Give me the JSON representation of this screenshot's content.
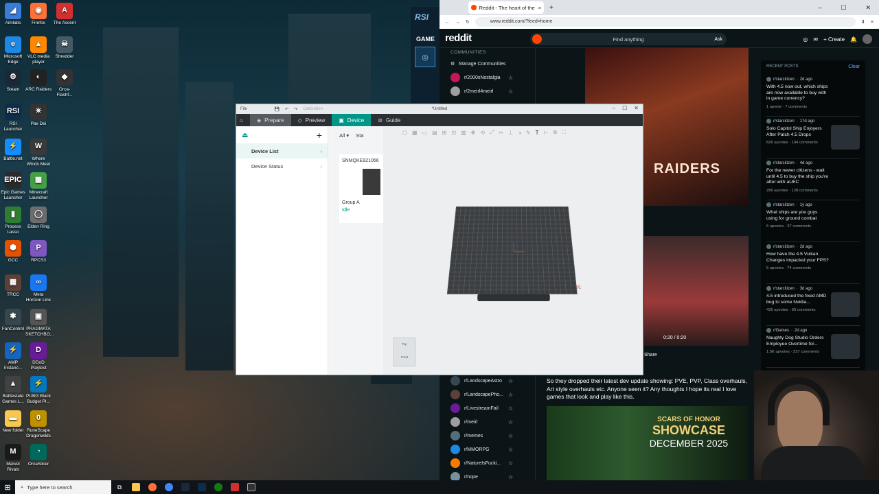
{
  "desktop": {
    "icons": [
      {
        "label": "Aimlabs",
        "glyph": "◢",
        "color": "#3a7bd5"
      },
      {
        "label": "Microsoft Edge",
        "glyph": "e",
        "color": "#1e88e5"
      },
      {
        "label": "Steam",
        "glyph": "⚙",
        "color": "#1b2838"
      },
      {
        "label": "RSI Launcher",
        "glyph": "RSI",
        "color": "#0d2d4a"
      },
      {
        "label": "Battle.net",
        "glyph": "⚡",
        "color": "#148eff"
      },
      {
        "label": "Epic Games Launcher",
        "glyph": "EPIC",
        "color": "#2a2a2a"
      },
      {
        "label": "Process Lasso",
        "glyph": "▮",
        "color": "#2e7d32"
      },
      {
        "label": "GCC",
        "glyph": "⬢",
        "color": "#e65100"
      },
      {
        "label": "TRCC",
        "glyph": "▦",
        "color": "#5d4037"
      },
      {
        "label": "FanControl",
        "glyph": "✱",
        "color": "#37474f"
      },
      {
        "label": "AMP Instanc...",
        "glyph": "⚡",
        "color": "#1565c0"
      },
      {
        "label": "Battlestate Games L...",
        "glyph": "▲",
        "color": "#424242"
      },
      {
        "label": "New folder",
        "glyph": "▬",
        "color": "#f9c74f"
      },
      {
        "label": "Marvel Rivals",
        "glyph": "M",
        "color": "#1a1a1a"
      },
      {
        "label": "Firefox",
        "glyph": "◉",
        "color": "#ff7139"
      },
      {
        "label": "VLC media player",
        "glyph": "▲",
        "color": "#ff8800"
      },
      {
        "label": "ARC Raiders",
        "glyph": "◐",
        "color": "#222"
      },
      {
        "label": "Pax Dei",
        "glyph": "✳",
        "color": "#333"
      },
      {
        "label": "Where Winds Meet",
        "glyph": "W",
        "color": "#3a3a3a"
      },
      {
        "label": "Minecraft Launcher",
        "glyph": "▩",
        "color": "#43a047"
      },
      {
        "label": "Elden Ring",
        "glyph": "◯",
        "color": "#6d6d6d"
      },
      {
        "label": "RPCS3",
        "glyph": "P",
        "color": "#7e57c2"
      },
      {
        "label": "Meta Horizon Link",
        "glyph": "∞",
        "color": "#1877f2"
      },
      {
        "label": "PRAGMATA SKETCHBO...",
        "glyph": "▣",
        "color": "#555"
      },
      {
        "label": "DDoD Playtest",
        "glyph": "D",
        "color": "#6a1b9a"
      },
      {
        "label": "PUBG Black Budget Pl...",
        "glyph": "⚡",
        "color": "#0277bd"
      },
      {
        "label": "RuneScape Dragonwilds",
        "glyph": "0",
        "color": "#bf9000"
      },
      {
        "label": "OrcaSlicer",
        "glyph": "◔",
        "color": "#00695c"
      },
      {
        "label": "The Ascent",
        "glyph": "A",
        "color": "#d32f2f"
      },
      {
        "label": "Shredder",
        "glyph": "☠",
        "color": "#455a64"
      },
      {
        "label": "Orca-Flashf...",
        "glyph": "◆",
        "color": "#333"
      }
    ]
  },
  "rsi_launcher": {
    "logo": "RSI",
    "game": "GAME"
  },
  "browser": {
    "tab_title": "Reddit - The heart of the intern",
    "url": "www.reddit.com/?feed=home",
    "reddit_logo": "reddit",
    "search_placeholder": "Find anything",
    "ask_label": "Ask",
    "create_label": "Create",
    "sidebar_heading": "COMMUNITIES",
    "manage_label": "Manage Communities",
    "communities_top": [
      {
        "name": "r/2000sNostalgia",
        "color": "#c2185b"
      },
      {
        "name": "r/2meirl4meirl",
        "color": "#9e9e9e"
      }
    ],
    "communities_bottom": [
      {
        "name": "r/LandscapeAstro",
        "color": "#37474f"
      },
      {
        "name": "r/LandscapePho...",
        "color": "#5d4037"
      },
      {
        "name": "r/LivestreamFail",
        "color": "#6a1b9a"
      },
      {
        "name": "r/meirl",
        "color": "#9e9e9e"
      },
      {
        "name": "r/memes",
        "color": "#546e7a"
      },
      {
        "name": "r/MMORPG",
        "color": "#1e88e5"
      },
      {
        "name": "r/NatureIsFucki...",
        "color": "#f57c00"
      },
      {
        "name": "r/nope",
        "color": "#78909c"
      }
    ],
    "feed": {
      "banner_text": "RAIDERS",
      "video_time": "0:20 / 0:20",
      "share_label": "Share",
      "post_text": "So they dropped their latest dev update showing: PVE, PVP, Class overhauls, Art style overhauls etc. Anyone seen it? Any thoughts I hope its real I love games that look and play like this.",
      "showcase_title": "SCARS OF HONOR",
      "showcase_sub": "SHOWCASE",
      "showcase_date": "DECEMBER 2025"
    },
    "recent": {
      "heading": "RECENT POSTS",
      "clear": "Clear",
      "posts": [
        {
          "sub": "r/starcitizen",
          "age": "2d ago",
          "title": "With 4.5 now out, which ships are now available to buy with in game currency?",
          "meta": "1 upvote · 7 comments",
          "thumb": false
        },
        {
          "sub": "r/starcitizen",
          "age": "17d ago",
          "title": "Solo Capitol Ship Enjoyers After Patch 4.5 Drops",
          "meta": "826 upvotes · 194 comments",
          "thumb": true
        },
        {
          "sub": "r/starcitizen",
          "age": "4d ago",
          "title": "For the newer citizens - wait until 4.5 to buy the ship you're after with aUEC",
          "meta": "286 upvotes · 128 comments",
          "thumb": false
        },
        {
          "sub": "r/starcitizen",
          "age": "1y ago",
          "title": "What ships are you guys using for ground combat",
          "meta": "6 upvotes · 37 comments",
          "thumb": false
        },
        {
          "sub": "r/starcitizen",
          "age": "2d ago",
          "title": "How have the 4.5 Vulkan Changes impacted your FPS?",
          "meta": "5 upvotes · 74 comments",
          "thumb": false
        },
        {
          "sub": "r/starcitizen",
          "age": "3d ago",
          "title": "4.5 introduced the fixed AMD bug to some Nvidia...",
          "meta": "425 upvotes · 69 comments",
          "thumb": true
        },
        {
          "sub": "r/Games",
          "age": "2d ago",
          "title": "Naughty Dog Studio Orders Employee Overtime for...",
          "meta": "1.5K upvotes · 237 comments",
          "thumb": true
        }
      ]
    }
  },
  "orca": {
    "menu_file": "File",
    "menu_calibration": "Calibration",
    "title": "*Untitled",
    "tabs": {
      "prepare": "Prepare",
      "preview": "Preview",
      "device": "Device",
      "guide": "Guide"
    },
    "nav": {
      "device_list": "Device List",
      "device_status": "Device Status"
    },
    "filter_all": "All",
    "filter_status": "Sta",
    "printer_id": "SNMQKE921066",
    "group": "Group A",
    "status": "Idle",
    "cube_top": "Top",
    "cube_front": "Front",
    "plate_label": "01"
  },
  "taskbar": {
    "search_placeholder": "Type here to search"
  }
}
